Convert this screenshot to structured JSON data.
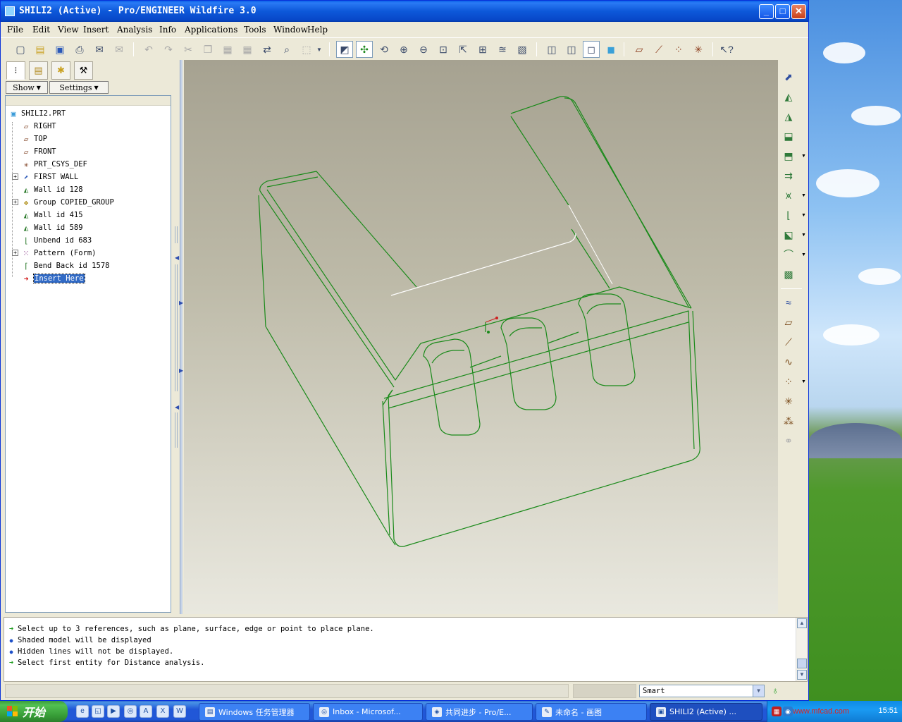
{
  "window": {
    "title": "SHILI2 (Active) - Pro/ENGINEER Wildfire 3.0",
    "min_label": "_",
    "max_label": "□",
    "close_label": "✕"
  },
  "menu": {
    "items": [
      "File",
      "Edit",
      "View",
      "Insert",
      "Analysis",
      "Info",
      "Applications",
      "Tools",
      "Window",
      "Help"
    ]
  },
  "model_tree": {
    "show_label": "Show",
    "settings_label": "Settings",
    "nodes": [
      {
        "label": "SHILI2.PRT",
        "icon": "part-icon"
      },
      {
        "label": "RIGHT",
        "icon": "datum-plane-icon"
      },
      {
        "label": "TOP",
        "icon": "datum-plane-icon"
      },
      {
        "label": "FRONT",
        "icon": "datum-plane-icon"
      },
      {
        "label": "PRT_CSYS_DEF",
        "icon": "csys-icon"
      },
      {
        "label": "FIRST WALL",
        "icon": "first-wall-icon",
        "expandable": true
      },
      {
        "label": "Wall id 128",
        "icon": "wall-icon"
      },
      {
        "label": "Group COPIED_GROUP",
        "icon": "group-icon",
        "expandable": true
      },
      {
        "label": "Wall id 415",
        "icon": "wall-icon"
      },
      {
        "label": "Wall id 589",
        "icon": "wall-icon"
      },
      {
        "label": "Unbend id 683",
        "icon": "unbend-icon"
      },
      {
        "label": "Pattern (Form)",
        "icon": "pattern-icon",
        "expandable": true
      },
      {
        "label": "Bend Back id 1578",
        "icon": "bend-back-icon"
      },
      {
        "label": "Insert Here",
        "icon": "insert-arrow-icon",
        "selected": true
      }
    ]
  },
  "messages": [
    {
      "icon": "prompt-arrow-icon",
      "text": "Select up to 3 references, such as plane, surface, edge or point to place plane."
    },
    {
      "icon": "info-dot-icon",
      "text": "Shaded model will be displayed"
    },
    {
      "icon": "info-dot-icon",
      "text": "Hidden lines will not be displayed."
    },
    {
      "icon": "prompt-arrow-icon",
      "text": "Select first entity for Distance analysis."
    }
  ],
  "status": {
    "filter_value": "Smart"
  },
  "taskbar": {
    "start_label": "开始",
    "tasks": [
      {
        "label": "Windows 任务管理器",
        "icon": "task-manager-icon"
      },
      {
        "label": "Inbox - Microsof...",
        "icon": "outlook-icon"
      },
      {
        "label": "共同进步 - Pro/E...",
        "icon": "browser-icon"
      },
      {
        "label": "未命名 - 画图",
        "icon": "paint-icon"
      },
      {
        "label": "SHILI2 (Active) ...",
        "icon": "proe-icon"
      }
    ],
    "watermark": "www.mfcad.com",
    "clock": "15:51"
  },
  "colors": {
    "wireframe": "#1a8a1a",
    "highlight_edge": "#ffffff"
  }
}
